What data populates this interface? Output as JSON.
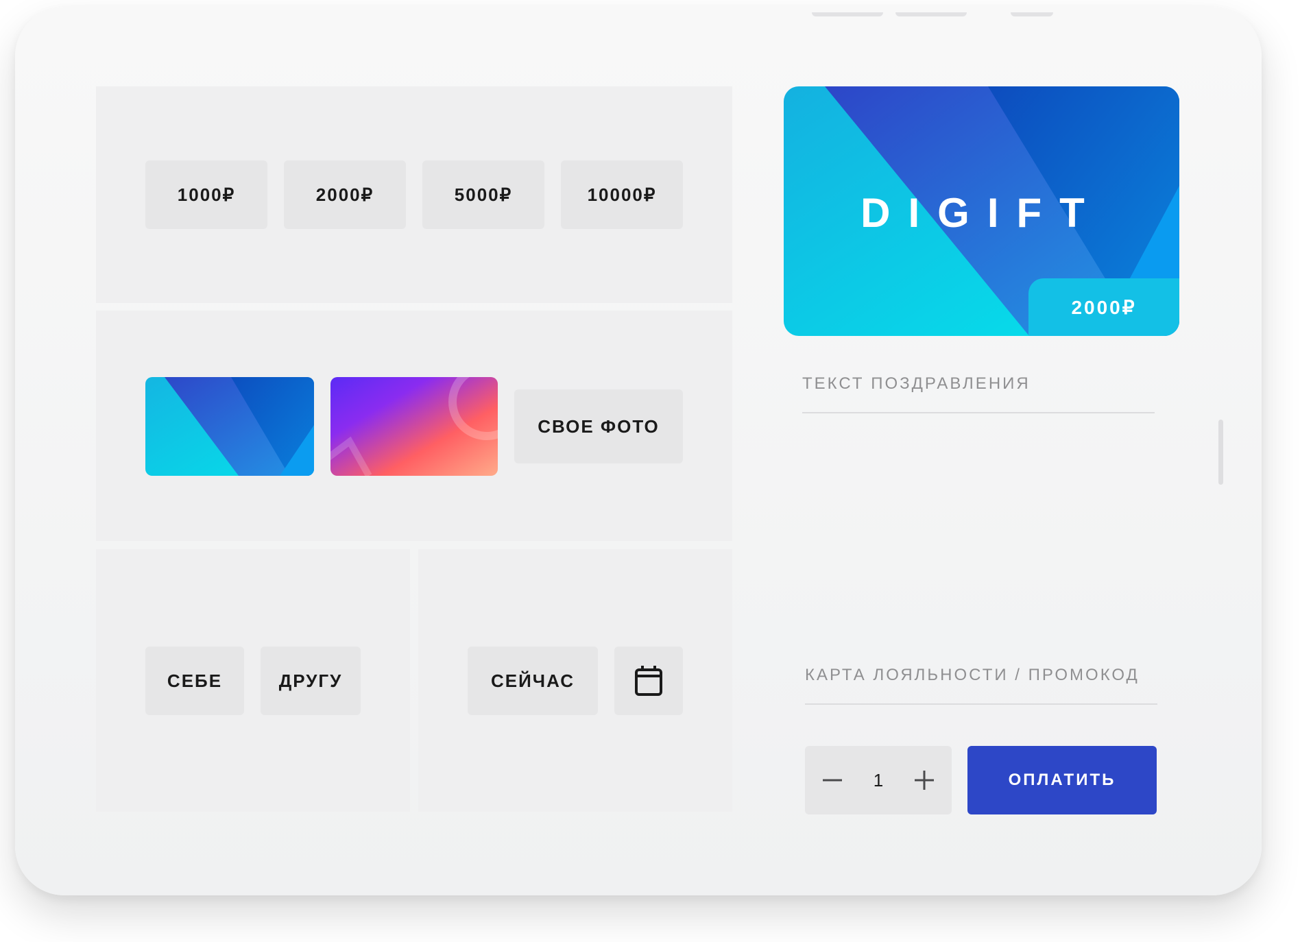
{
  "amounts": [
    "1000₽",
    "2000₽",
    "5000₽",
    "10000₽"
  ],
  "designs": {
    "own_photo_label": "СВОЕ ФОТО"
  },
  "recipient": {
    "self_label": "СЕБЕ",
    "friend_label": "ДРУГУ"
  },
  "delivery": {
    "now_label": "СЕЙЧАС"
  },
  "preview": {
    "brand": "DIGIFT",
    "amount": "2000₽"
  },
  "greeting": {
    "placeholder": "ТЕКСТ ПОЗДРАВЛЕНИЯ"
  },
  "promo": {
    "placeholder": "КАРТА ЛОЯЛЬНОСТИ / ПРОМОКОД"
  },
  "quantity": {
    "value": "1"
  },
  "pay": {
    "label": "ОПЛАТИТЬ"
  },
  "colors": {
    "accent": "#2d47c7",
    "card_cyan": "#0fc8e8",
    "card_blue": "#1a5fd0",
    "card_purple": "#7b2ff7",
    "card_coral": "#ff6b4d"
  }
}
